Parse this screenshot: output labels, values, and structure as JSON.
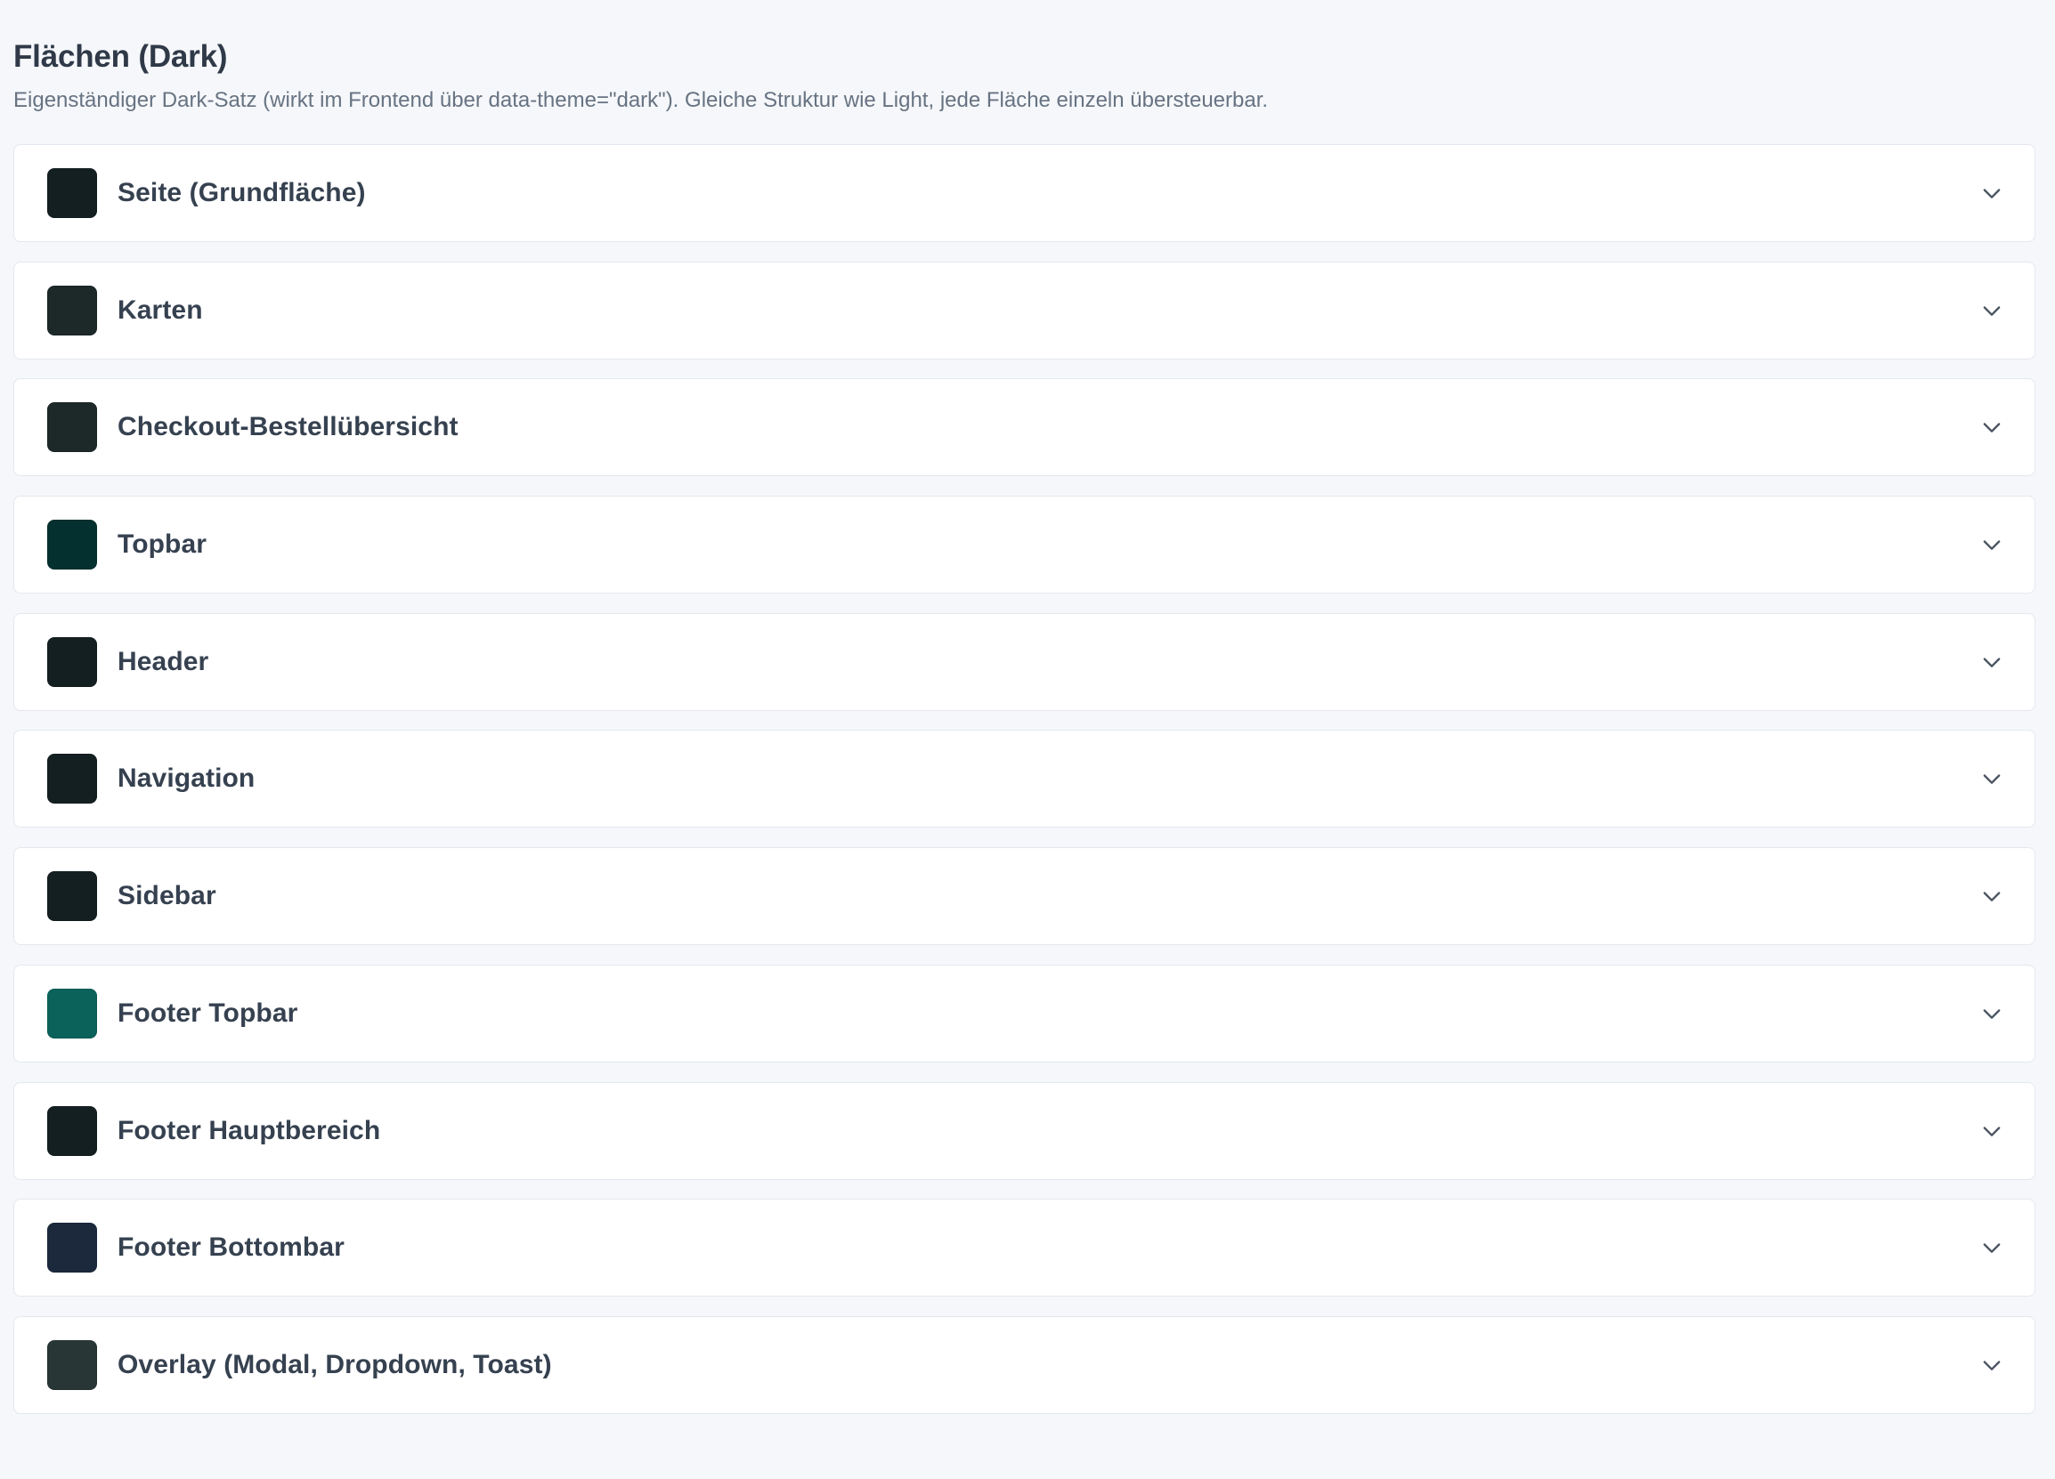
{
  "header": {
    "title": "Flächen (Dark)",
    "description": "Eigenständiger Dark-Satz (wirkt im Frontend über data-theme=\"dark\"). Gleiche Struktur wie Light, jede Fläche einzeln übersteuerbar."
  },
  "sections": [
    {
      "label": "Seite (Grundfläche)",
      "color": "#141f22",
      "icon": "chevron-down-icon"
    },
    {
      "label": "Karten",
      "color": "#1d2829",
      "icon": "chevron-down-icon"
    },
    {
      "label": "Checkout-Bestellübersicht",
      "color": "#1d2829",
      "icon": "chevron-down-icon"
    },
    {
      "label": "Topbar",
      "color": "#04312f",
      "icon": "chevron-down-icon"
    },
    {
      "label": "Header",
      "color": "#141f22",
      "icon": "chevron-down-icon"
    },
    {
      "label": "Navigation",
      "color": "#141f22",
      "icon": "chevron-down-icon"
    },
    {
      "label": "Sidebar",
      "color": "#141f22",
      "icon": "chevron-down-icon"
    },
    {
      "label": "Footer Topbar",
      "color": "#0b625b",
      "icon": "chevron-down-icon"
    },
    {
      "label": "Footer Hauptbereich",
      "color": "#141f22",
      "icon": "chevron-down-icon"
    },
    {
      "label": "Footer Bottombar",
      "color": "#1c293d",
      "icon": "chevron-down-icon"
    },
    {
      "label": "Overlay (Modal, Dropdown, Toast)",
      "color": "#283636",
      "icon": "chevron-down-icon"
    }
  ],
  "colors": {
    "background": "#f5f7fa",
    "card": "#ffffff",
    "border": "#e4e8ee",
    "text": "#364150",
    "muted": "#677382"
  }
}
